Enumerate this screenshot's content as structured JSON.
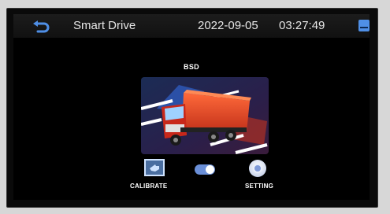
{
  "header": {
    "title": "Smart Drive",
    "date": "2022-09-05",
    "time": "03:27:49",
    "back_icon": "back-arrow-icon",
    "status_icon": "storage-icon"
  },
  "feature": {
    "title": "BSD",
    "image": "truck-blind-spot-illustration"
  },
  "controls": {
    "calibrate_label": "CALIBRATE",
    "calibrate_icon": "hand-pointer-icon",
    "toggle_state": "on",
    "setting_label": "SETTING",
    "setting_icon": "disc-icon"
  },
  "colors": {
    "accent": "#5b86e5",
    "background": "#000000",
    "header_text": "#e6e6e6"
  }
}
